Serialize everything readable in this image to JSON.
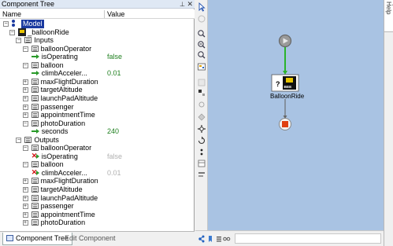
{
  "panel": {
    "title": "Component Tree",
    "pin_glyph": "⊥",
    "close_glyph": "✕",
    "columns": {
      "name": "Name",
      "value": "Value"
    }
  },
  "tree": [
    {
      "indent": 0,
      "exp": "-",
      "icon": "model",
      "label": "Model",
      "selected": true
    },
    {
      "indent": 1,
      "exp": "-",
      "icon": "bee",
      "label": "_balloonRide"
    },
    {
      "indent": 2,
      "exp": "-",
      "icon": "folder",
      "label": "Inputs"
    },
    {
      "indent": 3,
      "exp": "-",
      "icon": "folder",
      "label": "balloonOperator"
    },
    {
      "indent": 4,
      "exp": "",
      "icon": "varr",
      "label": "isOperating",
      "value": "false"
    },
    {
      "indent": 3,
      "exp": "-",
      "icon": "folder",
      "label": "balloon"
    },
    {
      "indent": 4,
      "exp": "",
      "icon": "varr",
      "label": "climbAcceler...",
      "value": "0.01"
    },
    {
      "indent": 3,
      "exp": "+",
      "icon": "folder",
      "label": "maxFlightDuration"
    },
    {
      "indent": 3,
      "exp": "+",
      "icon": "folder",
      "label": "targetAltitude"
    },
    {
      "indent": 3,
      "exp": "+",
      "icon": "folder",
      "label": "launchPadAltitude"
    },
    {
      "indent": 3,
      "exp": "+",
      "icon": "folder",
      "label": "passenger"
    },
    {
      "indent": 3,
      "exp": "+",
      "icon": "folder",
      "label": "appointmentTime"
    },
    {
      "indent": 3,
      "exp": "-",
      "icon": "folder",
      "label": "photoDuration"
    },
    {
      "indent": 4,
      "exp": "",
      "icon": "varr",
      "label": "seconds",
      "value": "240"
    },
    {
      "indent": 2,
      "exp": "-",
      "icon": "folder",
      "label": "Outputs"
    },
    {
      "indent": 3,
      "exp": "-",
      "icon": "folder",
      "label": "balloonOperator"
    },
    {
      "indent": 4,
      "exp": "",
      "icon": "varx",
      "label": "isOperating",
      "value": "false",
      "dim": true
    },
    {
      "indent": 3,
      "exp": "-",
      "icon": "folder",
      "label": "balloon"
    },
    {
      "indent": 4,
      "exp": "",
      "icon": "varx",
      "label": "climbAcceler...",
      "value": "0.01",
      "dim": true
    },
    {
      "indent": 3,
      "exp": "+",
      "icon": "folder",
      "label": "maxFlightDuration"
    },
    {
      "indent": 3,
      "exp": "+",
      "icon": "folder",
      "label": "targetAltitude"
    },
    {
      "indent": 3,
      "exp": "+",
      "icon": "folder",
      "label": "launchPadAltitude"
    },
    {
      "indent": 3,
      "exp": "+",
      "icon": "folder",
      "label": "passenger"
    },
    {
      "indent": 3,
      "exp": "+",
      "icon": "folder",
      "label": "appointmentTime"
    },
    {
      "indent": 3,
      "exp": "+",
      "icon": "folder",
      "label": "photoDuration"
    }
  ],
  "tabs": {
    "active": "Component Tree",
    "inactive": "Edit Component"
  },
  "canvas": {
    "node_label": "BalloonRide",
    "node_badge": "BEE",
    "node_question": "?",
    "background": "#a9c3e3",
    "flow_color": "#2bb32b",
    "end_color": "#e04010"
  },
  "right_sidebar": {
    "label": "Quick Help"
  },
  "toolbar_icons": [
    "pointer-icon",
    "connect-icon",
    "zoom-fit-icon",
    "zoom-in-icon",
    "zoom-out-icon",
    "grid-icon",
    "blank-icon",
    "node-icon",
    "link-icon",
    "diamond-icon",
    "move-icon",
    "rotate-icon",
    "dots-icon",
    "table-icon",
    "align-icon"
  ],
  "bottom_icons": [
    "network-icon",
    "bookmark-icon",
    "list-icon",
    "glasses-icon"
  ]
}
